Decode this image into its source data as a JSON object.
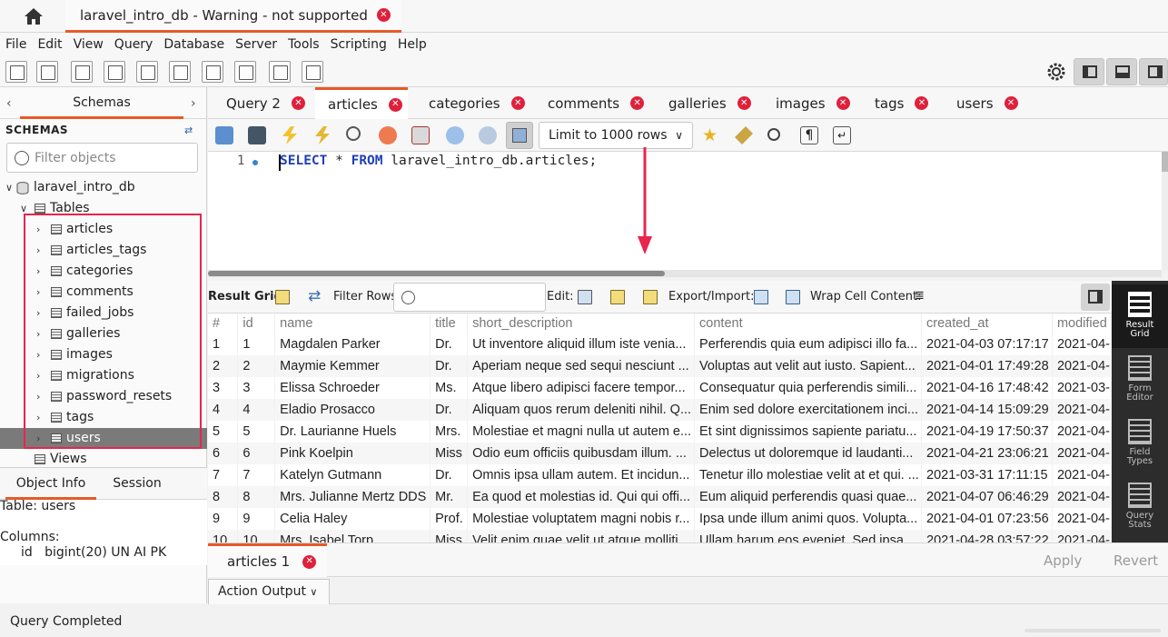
{
  "window": {
    "tab_title": "laravel_intro_db - Warning - not supported"
  },
  "menu": [
    "File",
    "Edit",
    "View",
    "Query",
    "Database",
    "Server",
    "Tools",
    "Scripting",
    "Help"
  ],
  "sidebar": {
    "tab_label": "Schemas",
    "section_label": "SCHEMAS",
    "filter_placeholder": "Filter objects",
    "schema_name": "laravel_intro_db",
    "tables_label": "Tables",
    "tables": [
      "articles",
      "articles_tags",
      "categories",
      "comments",
      "failed_jobs",
      "galleries",
      "images",
      "migrations",
      "password_resets",
      "tags",
      "users"
    ],
    "selected_table": "users",
    "views_label": "Views"
  },
  "object_info": {
    "tabs": [
      "Object Info",
      "Session"
    ],
    "table_line": "Table: users",
    "columns_label": "Columns:",
    "column_line": "id   bigint(20) UN AI PK"
  },
  "query_tabs": [
    {
      "label": "Query 2"
    },
    {
      "label": "articles",
      "active": true
    },
    {
      "label": "categories"
    },
    {
      "label": "comments"
    },
    {
      "label": "galleries"
    },
    {
      "label": "images"
    },
    {
      "label": "tags"
    },
    {
      "label": "users"
    }
  ],
  "sql_toolbar": {
    "limit_label": "Limit to 1000 rows"
  },
  "editor": {
    "line_number": "1",
    "sql_keyword1": "SELECT",
    "sql_middle": " * ",
    "sql_keyword2": "FROM",
    "sql_rest": " laravel_intro_db.articles;"
  },
  "result_toolbar": {
    "result_grid_label": "Result Grid",
    "filter_rows_label": "Filter Rows:",
    "edit_label": "Edit:",
    "export_label": "Export/Import:",
    "wrap_label": "Wrap Cell Content:"
  },
  "grid": {
    "columns": [
      "#",
      "id",
      "name",
      "title",
      "short_description",
      "content",
      "created_at",
      "modified"
    ],
    "rows": [
      [
        "1",
        "1",
        "Magdalen Parker",
        "Dr.",
        "Ut inventore aliquid illum iste venia...",
        "Perferendis quia eum adipisci illo fa...",
        "2021-04-03 07:17:17",
        "2021-04-"
      ],
      [
        "2",
        "2",
        "Maymie Kemmer",
        "Dr.",
        "Aperiam neque sed sequi nesciunt ...",
        "Voluptas aut velit aut iusto. Sapient...",
        "2021-04-01 17:49:28",
        "2021-04-"
      ],
      [
        "3",
        "3",
        "Elissa Schroeder",
        "Ms.",
        "Atque libero adipisci facere tempor...",
        "Consequatur quia perferendis simili...",
        "2021-04-16 17:48:42",
        "2021-03-"
      ],
      [
        "4",
        "4",
        "Eladio Prosacco",
        "Dr.",
        "Aliquam quos rerum deleniti nihil. Q...",
        "Enim sed dolore exercitationem inci...",
        "2021-04-14 15:09:29",
        "2021-04-"
      ],
      [
        "5",
        "5",
        "Dr. Laurianne Huels",
        "Mrs.",
        "Molestiae et magni nulla ut autem e...",
        "Et sint dignissimos sapiente pariatu...",
        "2021-04-19 17:50:37",
        "2021-04-"
      ],
      [
        "6",
        "6",
        "Pink Koelpin",
        "Miss",
        "Odio eum officiis quibusdam illum. ...",
        "Delectus ut doloremque id laudanti...",
        "2021-04-21 23:06:21",
        "2021-04-"
      ],
      [
        "7",
        "7",
        "Katelyn Gutmann",
        "Dr.",
        "Omnis ipsa ullam autem. Et incidun...",
        "Tenetur illo molestiae velit at et qui. ...",
        "2021-03-31 17:11:15",
        "2021-04-"
      ],
      [
        "8",
        "8",
        "Mrs. Julianne Mertz DDS",
        "Mr.",
        "Ea quod et molestias id. Qui qui offi...",
        "Eum aliquid perferendis quasi quae...",
        "2021-04-07 06:46:29",
        "2021-04-"
      ],
      [
        "9",
        "9",
        "Celia Haley",
        "Prof.",
        "Molestiae voluptatem magni nobis r...",
        "Ipsa unde illum animi quos. Volupta...",
        "2021-04-01 07:23:56",
        "2021-04-"
      ],
      [
        "10",
        "10",
        "Mrs. Isabel Torp",
        "Miss",
        "Velit enim quae velit ut atque molliti...",
        "Ullam harum eos eveniet. Sed ipsa...",
        "2021-04-28 03:57:22",
        "2021-04-"
      ]
    ]
  },
  "right_panel": {
    "items": [
      {
        "label1": "Result",
        "label2": "Grid",
        "active": true
      },
      {
        "label1": "Form",
        "label2": "Editor"
      },
      {
        "label1": "Field",
        "label2": "Types"
      },
      {
        "label1": "Query",
        "label2": "Stats"
      }
    ]
  },
  "result_tabs": {
    "tab_label": "articles 1",
    "apply_label": "Apply",
    "revert_label": "Revert"
  },
  "action_output": {
    "label": "Action Output"
  },
  "status": {
    "text": "Query Completed"
  },
  "colors": {
    "accent": "#e65a28",
    "close_red": "#e0203b",
    "highlight_red": "#e8254d",
    "sql_keyword": "#1f3fb8"
  }
}
